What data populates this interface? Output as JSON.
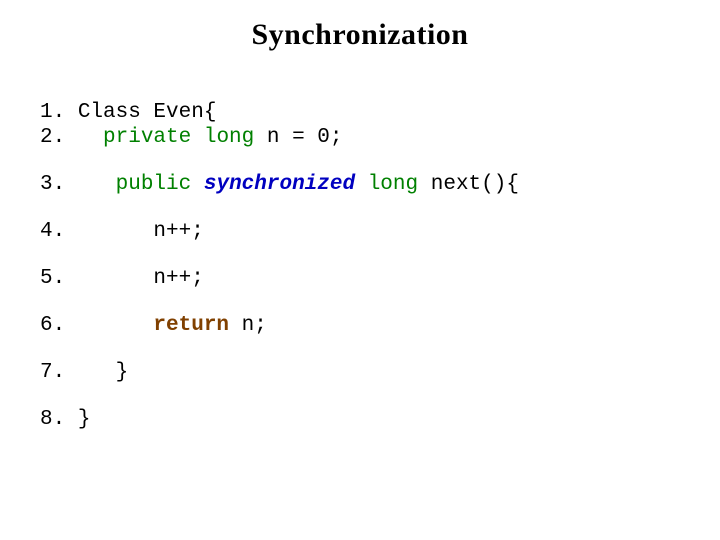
{
  "title": "Synchronization",
  "code": {
    "l1_num": "1. ",
    "l1_a": "Class Even{",
    "l2_num": "2.   ",
    "l2_kw1": "private",
    "l2_sp1": " ",
    "l2_kw2": "long",
    "l2_rest": " n = 0;",
    "l3_num": "3.    ",
    "l3_kw1": "public",
    "l3_sp1": " ",
    "l3_kw2": "synchronized",
    "l3_sp2": " ",
    "l3_kw3": "long",
    "l3_sp3": " ",
    "l3_id": "next(){",
    "l4_num": "4.       ",
    "l4_stmt": "n++;",
    "l5_num": "5.       ",
    "l5_stmt": "n++;",
    "l6_num": "6.       ",
    "l6_kw": "return",
    "l6_sp": " ",
    "l6_rest": "n;",
    "l7_num": "7.    ",
    "l7_stmt": "}",
    "l8_num": "8. ",
    "l8_stmt": "}"
  }
}
